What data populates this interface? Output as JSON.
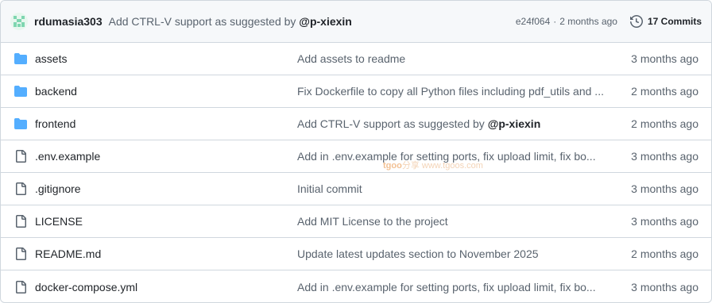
{
  "header": {
    "author": "rdumasia303",
    "message_prefix": "Add CTRL-V support as suggested by",
    "message_mention": "@p-xiexin",
    "sha": "e24f064",
    "separator": "·",
    "age": "2 months ago",
    "commits_label": "17 Commits",
    "avatar_icon": "identicon-avatar",
    "history_icon": "history-icon"
  },
  "files": [
    {
      "type": "dir",
      "icon": "folder-icon",
      "name": "assets",
      "message": "Add assets to readme",
      "age": "3 months ago"
    },
    {
      "type": "dir",
      "icon": "folder-icon",
      "name": "backend",
      "message": "Fix Dockerfile to copy all Python files including pdf_utils and ...",
      "age": "2 months ago"
    },
    {
      "type": "dir",
      "icon": "folder-icon",
      "name": "frontend",
      "message": "Add CTRL-V support as suggested by ",
      "mention": "@p-xiexin",
      "age": "2 months ago"
    },
    {
      "type": "file",
      "icon": "file-icon",
      "name": ".env.example",
      "message": "Add in .env.example for setting ports, fix upload limit, fix bo...",
      "age": "3 months ago"
    },
    {
      "type": "file",
      "icon": "file-icon",
      "name": ".gitignore",
      "message": "Initial commit",
      "age": "3 months ago"
    },
    {
      "type": "file",
      "icon": "file-icon",
      "name": "LICENSE",
      "message": "Add MIT License to the project",
      "age": "3 months ago"
    },
    {
      "type": "file",
      "icon": "file-icon",
      "name": "README.md",
      "message": "Update latest updates section to November 2025",
      "age": "2 months ago"
    },
    {
      "type": "file",
      "icon": "file-icon",
      "name": "docker-compose.yml",
      "message": "Add in .env.example for setting ports, fix upload limit, fix bo...",
      "age": "3 months ago"
    }
  ],
  "watermark": {
    "brand": "tgoo",
    "cn": "分享",
    "url": "www.tgoos.com"
  },
  "colors": {
    "folder": "#54aeff",
    "file": "#59636e",
    "text": "#1f2328",
    "muted": "#59636e",
    "border": "#d0d7de",
    "header_bg": "#f6f8fa"
  }
}
